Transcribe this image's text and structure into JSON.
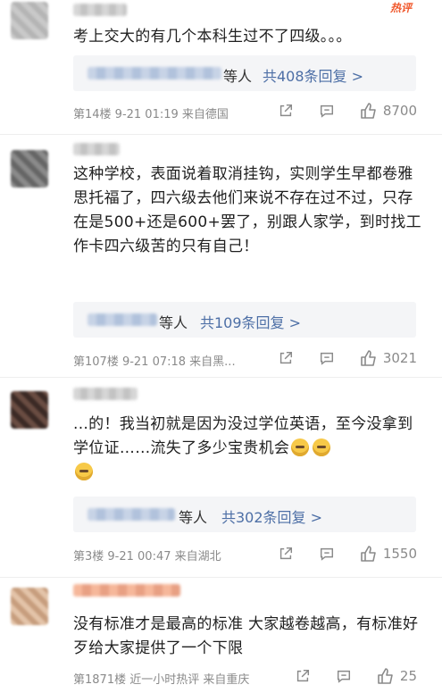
{
  "comments": [
    {
      "hot": "热评",
      "text": "考上交大的有几个本科生过不了四级。。。",
      "reply_who": "等人",
      "reply_link": "共408条回复 >",
      "meta": "第14楼  9-21 01:19  来自德国",
      "likes": "8700"
    },
    {
      "text": "这种学校，表面说着取消挂钩，实则学生早都卷雅思托福了，四六级去他们来说不存在过不过，只存在是500+还是600+罢了，别跟人家学，到时找工作卡四六级苦的只有自己！",
      "reply_who": "等人",
      "reply_link": "共109条回复 >",
      "meta": "第107楼  9-21 07:18  来自黑...",
      "likes": "3021"
    },
    {
      "text": "...的！我当初就是因为没过学位英语，至今没拿到学位证……流失了多少宝贵机会",
      "reply_who": "等人",
      "reply_link": "共302条回复 >",
      "meta": "第3楼  9-21 00:47  来自湖北",
      "likes": "1550"
    },
    {
      "text": "没有标准才是最高的标准 大家越卷越高，有标准好歹给大家提供了一个下限",
      "meta": "第1871楼  近一小时热评  来自重庆",
      "likes": "25"
    }
  ],
  "icons": {
    "share": "share-icon",
    "comment": "comment-icon",
    "like": "thumbs-up-icon"
  }
}
